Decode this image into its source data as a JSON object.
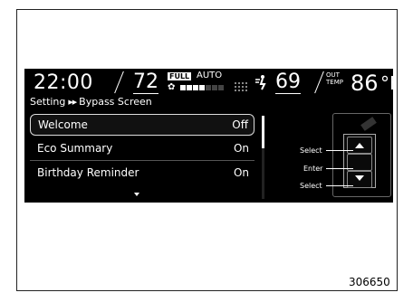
{
  "status_bar": {
    "time": "22:00",
    "driver_temp": "72",
    "full_badge": "FULL",
    "auto_label": "AUTO",
    "fan_level": 4,
    "fan_max": 7,
    "passenger_temp": "69",
    "out_temp_label_line1": "OUT",
    "out_temp_label_line2": "TEMP",
    "out_temp_value": "86",
    "out_temp_unit": "°F"
  },
  "breadcrumb": {
    "parent": "Setting",
    "separator": "▶▶",
    "current": "Bypass Screen"
  },
  "list": {
    "items": [
      {
        "label": "Welcome",
        "value": "Off",
        "selected": true
      },
      {
        "label": "Eco Summary",
        "value": "On",
        "selected": false
      },
      {
        "label": "Birthday Reminder",
        "value": "On",
        "selected": false
      }
    ]
  },
  "controller": {
    "select_up_label": "Select",
    "enter_label": "Enter",
    "select_down_label": "Select"
  },
  "figure_number": "306650",
  "icons": {
    "fan": "fan-icon",
    "vent": "vent-mode-icon",
    "more": "more-down-arrow-icon",
    "up": "up-arrow-icon",
    "down": "down-arrow-icon"
  }
}
